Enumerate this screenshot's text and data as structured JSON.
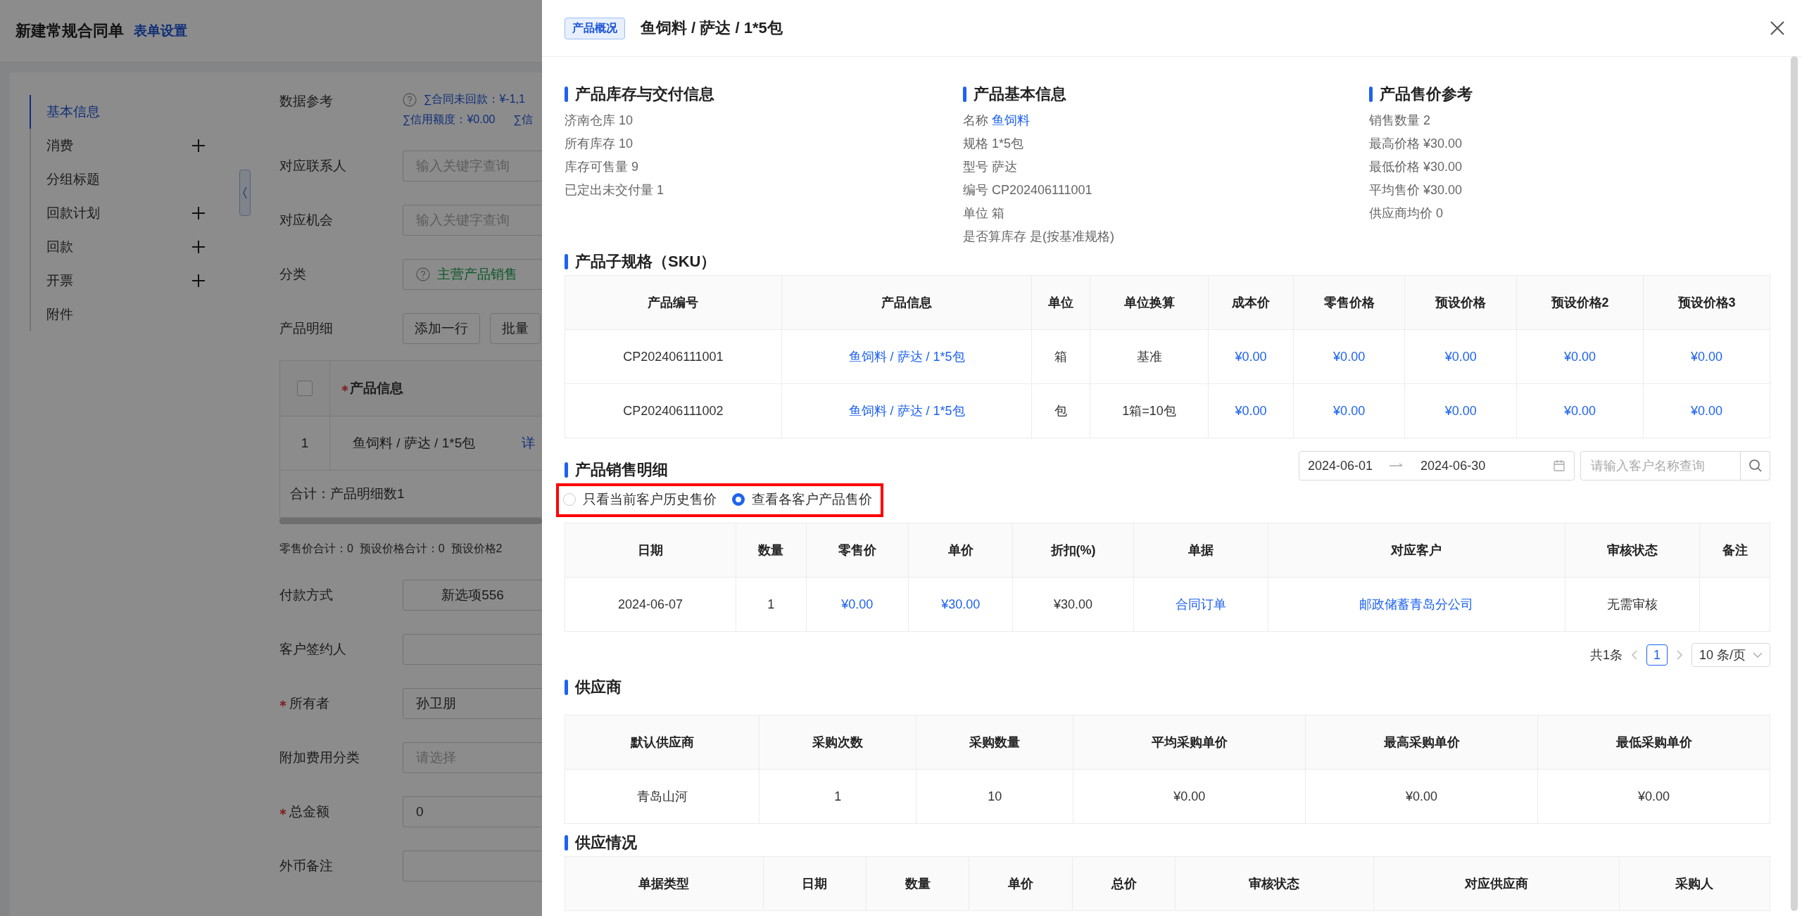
{
  "page": {
    "title": "新建常规合同单",
    "settings_link": "表单设置"
  },
  "nav": [
    {
      "label": "基本信息",
      "selected": true,
      "expandable": false
    },
    {
      "label": "消费",
      "selected": false,
      "expandable": true
    },
    {
      "label": "分组标题",
      "selected": false,
      "expandable": false
    },
    {
      "label": "回款计划",
      "selected": false,
      "expandable": true
    },
    {
      "label": "回款",
      "selected": false,
      "expandable": true
    },
    {
      "label": "开票",
      "selected": false,
      "expandable": true
    },
    {
      "label": "附件",
      "selected": false,
      "expandable": false
    }
  ],
  "form": {
    "reference": {
      "label": "数据参考",
      "line_1": "∑合同未回款：¥-1,1",
      "line_2": [
        "∑信用额度：¥0.00",
        "∑信"
      ]
    },
    "lookup_fields": [
      {
        "label": "对应联系人",
        "placeholder": "输入关键字查询"
      },
      {
        "label": "对应机会",
        "placeholder": "输入关键字查询"
      }
    ],
    "category": {
      "label": "分类",
      "value": "主营产品销售"
    },
    "product_detail": {
      "label": "产品明细",
      "buttons": [
        "添加一行",
        "批量"
      ],
      "header_checked": false,
      "header": "产品信息",
      "rows": [
        {
          "index": "1",
          "product": "鱼饲料 / 萨达 / 1*5包",
          "link": "详"
        }
      ],
      "summary": "合计：产品明细数1"
    },
    "totals": "零售价合计：0  预设价格合计：0  预设价格2",
    "fields": [
      {
        "label": "付款方式",
        "required": false,
        "value": "新选项556",
        "centered": true
      },
      {
        "label": "客户签约人",
        "required": false
      },
      {
        "label": "所有者",
        "required": true,
        "value": "孙卫朋",
        "centered": false
      },
      {
        "label": "附加费用分类",
        "required": false,
        "placeholder": "请选择",
        "centered": false
      },
      {
        "label": "总金额",
        "required": true,
        "value": "0",
        "centered": false
      },
      {
        "label": "外币备注",
        "required": false
      }
    ]
  },
  "drawer": {
    "tag": "产品概况",
    "title": "鱼饲料 / 萨达 / 1*5包",
    "info_columns": [
      {
        "title": "产品库存与交付信息",
        "items": [
          {
            "label": "济南仓库",
            "value": "10",
            "link": false
          },
          {
            "label": "所有库存",
            "value": "10",
            "link": false
          },
          {
            "label": "库存可售量",
            "value": "9",
            "link": false
          },
          {
            "label": "已定出未交付量",
            "value": "1",
            "link": false
          }
        ]
      },
      {
        "title": "产品基本信息",
        "items": [
          {
            "label": "名称",
            "value": "鱼饲料",
            "link": true
          },
          {
            "label": "规格",
            "value": "1*5包",
            "link": false
          },
          {
            "label": "型号",
            "value": "萨达",
            "link": false
          },
          {
            "label": "编号",
            "value": "CP202406111001",
            "link": false
          },
          {
            "label": "单位",
            "value": "箱",
            "link": false
          },
          {
            "label": "是否算库存",
            "value": "是(按基准规格)",
            "link": false
          }
        ]
      },
      {
        "title": "产品售价参考",
        "items": [
          {
            "label": "销售数量",
            "value": "2",
            "link": false
          },
          {
            "label": "最高价格",
            "value": "¥30.00",
            "link": false
          },
          {
            "label": "最低价格",
            "value": "¥30.00",
            "link": false
          },
          {
            "label": "平均售价",
            "value": "¥30.00",
            "link": false
          },
          {
            "label": "供应商均价",
            "value": "0",
            "link": false
          }
        ]
      }
    ],
    "sku": {
      "title": "产品子规格（SKU）",
      "columns": [
        {
          "label": "产品编号",
          "link": false
        },
        {
          "label": "产品信息",
          "link": true
        },
        {
          "label": "单位",
          "link": false
        },
        {
          "label": "单位换算",
          "link": false
        },
        {
          "label": "成本价",
          "link": true
        },
        {
          "label": "零售价格",
          "link": true
        },
        {
          "label": "预设价格",
          "link": true
        },
        {
          "label": "预设价格2",
          "link": true
        },
        {
          "label": "预设价格3",
          "link": true
        }
      ],
      "rows": [
        [
          "CP202406111001",
          "鱼饲料 / 萨达 / 1*5包",
          "箱",
          "基准",
          "¥0.00",
          "¥0.00",
          "¥0.00",
          "¥0.00",
          "¥0.00"
        ],
        [
          "CP202406111002",
          "鱼饲料 / 萨达 / 1*5包",
          "包",
          "1箱=10包",
          "¥0.00",
          "¥0.00",
          "¥0.00",
          "¥0.00",
          "¥0.00"
        ]
      ]
    },
    "sales": {
      "title": "产品销售明细",
      "date_start": "2024-06-01",
      "date_end": "2024-06-30",
      "search_placeholder": "请输入客户名称查询",
      "radios": [
        {
          "label": "只看当前客户历史售价",
          "selected": false
        },
        {
          "label": "查看各客户产品售价",
          "selected": true
        }
      ],
      "columns": [
        {
          "label": "日期",
          "link": false
        },
        {
          "label": "数量",
          "link": false
        },
        {
          "label": "零售价",
          "link": true
        },
        {
          "label": "单价",
          "link": true
        },
        {
          "label": "折扣(%)",
          "link": false
        },
        {
          "label": "单据",
          "link": true
        },
        {
          "label": "对应客户",
          "link": true
        },
        {
          "label": "审核状态",
          "link": false
        },
        {
          "label": "备注"
        }
      ],
      "rows": [
        [
          "2024-06-07",
          "1",
          "¥0.00",
          "¥30.00",
          "¥30.00",
          "合同订单",
          "邮政储蓄青岛分公司",
          "无需审核",
          ""
        ]
      ],
      "total": "共1条",
      "pages": [
        {
          "label": "1",
          "selected": true
        }
      ],
      "page_size": "10 条/页"
    },
    "supplier": {
      "title": "供应商",
      "columns": [
        {
          "label": "默认供应商",
          "link": false
        },
        {
          "label": "采购次数",
          "link": false
        },
        {
          "label": "采购数量",
          "link": false
        },
        {
          "label": "平均采购单价",
          "link": false
        },
        {
          "label": "最高采购单价",
          "link": false
        },
        {
          "label": "最低采购单价",
          "link": false
        }
      ],
      "rows": [
        [
          "青岛山河",
          "1",
          "10",
          "¥0.00",
          "¥0.00",
          "¥0.00"
        ]
      ]
    },
    "supply": {
      "title": "供应情况",
      "columns": [
        {
          "label": "单据类型"
        },
        {
          "label": "日期"
        },
        {
          "label": "数量"
        },
        {
          "label": "单价"
        },
        {
          "label": "总价"
        },
        {
          "label": "审核状态"
        },
        {
          "label": "对应供应商"
        },
        {
          "label": "采购人"
        }
      ]
    }
  }
}
